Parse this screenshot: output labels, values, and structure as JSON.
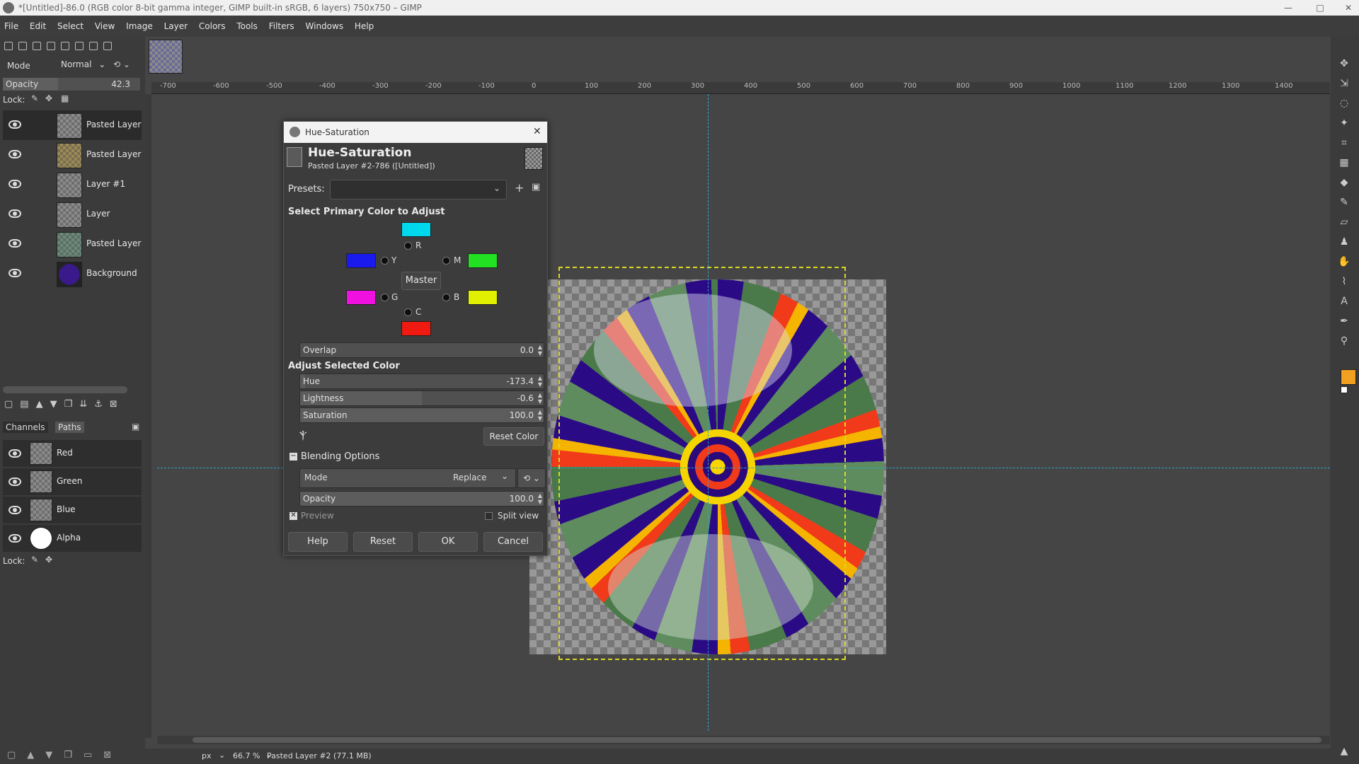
{
  "window": {
    "title": "*[Untitled]-86.0 (RGB color 8-bit gamma integer, GIMP built-in sRGB, 6 layers) 750x750 – GIMP"
  },
  "menubar": [
    "File",
    "Edit",
    "Select",
    "View",
    "Image",
    "Layer",
    "Colors",
    "Tools",
    "Filters",
    "Windows",
    "Help"
  ],
  "layers_panel": {
    "mode_label": "Mode",
    "mode_value": "Normal",
    "opacity_label": "Opacity",
    "opacity_value": "42.3",
    "lock_label": "Lock:",
    "layers": [
      {
        "name": "Pasted Layer"
      },
      {
        "name": "Pasted Layer"
      },
      {
        "name": "Layer #1"
      },
      {
        "name": "Layer"
      },
      {
        "name": "Pasted Layer"
      },
      {
        "name": "Background"
      }
    ]
  },
  "channels_panel": {
    "tabs": [
      "Channels",
      "Paths"
    ],
    "channels": [
      {
        "name": "Red"
      },
      {
        "name": "Green"
      },
      {
        "name": "Blue"
      },
      {
        "name": "Alpha"
      }
    ],
    "lock_label": "Lock:"
  },
  "ruler": {
    "top_ticks": [
      "-700",
      "-600",
      "-500",
      "-400",
      "-300",
      "-200",
      "-100",
      "0",
      "100",
      "200",
      "300",
      "400",
      "500",
      "600",
      "700",
      "800",
      "900",
      "1000",
      "1100",
      "1200",
      "1300",
      "1400"
    ]
  },
  "statusbar": {
    "unit": "px",
    "zoom": "66.7 %",
    "info": "Pasted Layer #2 (77.1 MB)"
  },
  "dialog": {
    "window_title": "Hue-Saturation",
    "heading": "Hue-Saturation",
    "subheading": "Pasted Layer #2-786 ([Untitled])",
    "presets_label": "Presets:",
    "select_primary_label": "Select Primary Color to Adjust",
    "primaries": {
      "R": "R",
      "Y": "Y",
      "M": "M",
      "G": "G",
      "B": "B",
      "C": "C",
      "master": "Master"
    },
    "swatch_colors": {
      "top": "#00d8ee",
      "upper_left": "#1a1aee",
      "upper_right": "#22e022",
      "lower_left": "#f010e0",
      "lower_right": "#e0f000",
      "bottom": "#f01a10"
    },
    "overlap": {
      "label": "Overlap",
      "value": "0.0"
    },
    "adjust_label": "Adjust Selected Color",
    "hue": {
      "label": "Hue",
      "value": "-173.4",
      "fill": 0.02
    },
    "lightness": {
      "label": "Lightness",
      "value": "-0.6",
      "fill": 0.5
    },
    "saturation": {
      "label": "Saturation",
      "value": "100.0",
      "fill": 1.0
    },
    "reset_color": "Reset Color",
    "blending_label": "Blending Options",
    "mode_label": "Mode",
    "mode_value": "Replace",
    "opacity": {
      "label": "Opacity",
      "value": "100.0",
      "fill": 1.0
    },
    "preview_label": "Preview",
    "split_view_label": "Split view",
    "buttons": {
      "help": "Help",
      "reset": "Reset",
      "ok": "OK",
      "cancel": "Cancel"
    }
  }
}
